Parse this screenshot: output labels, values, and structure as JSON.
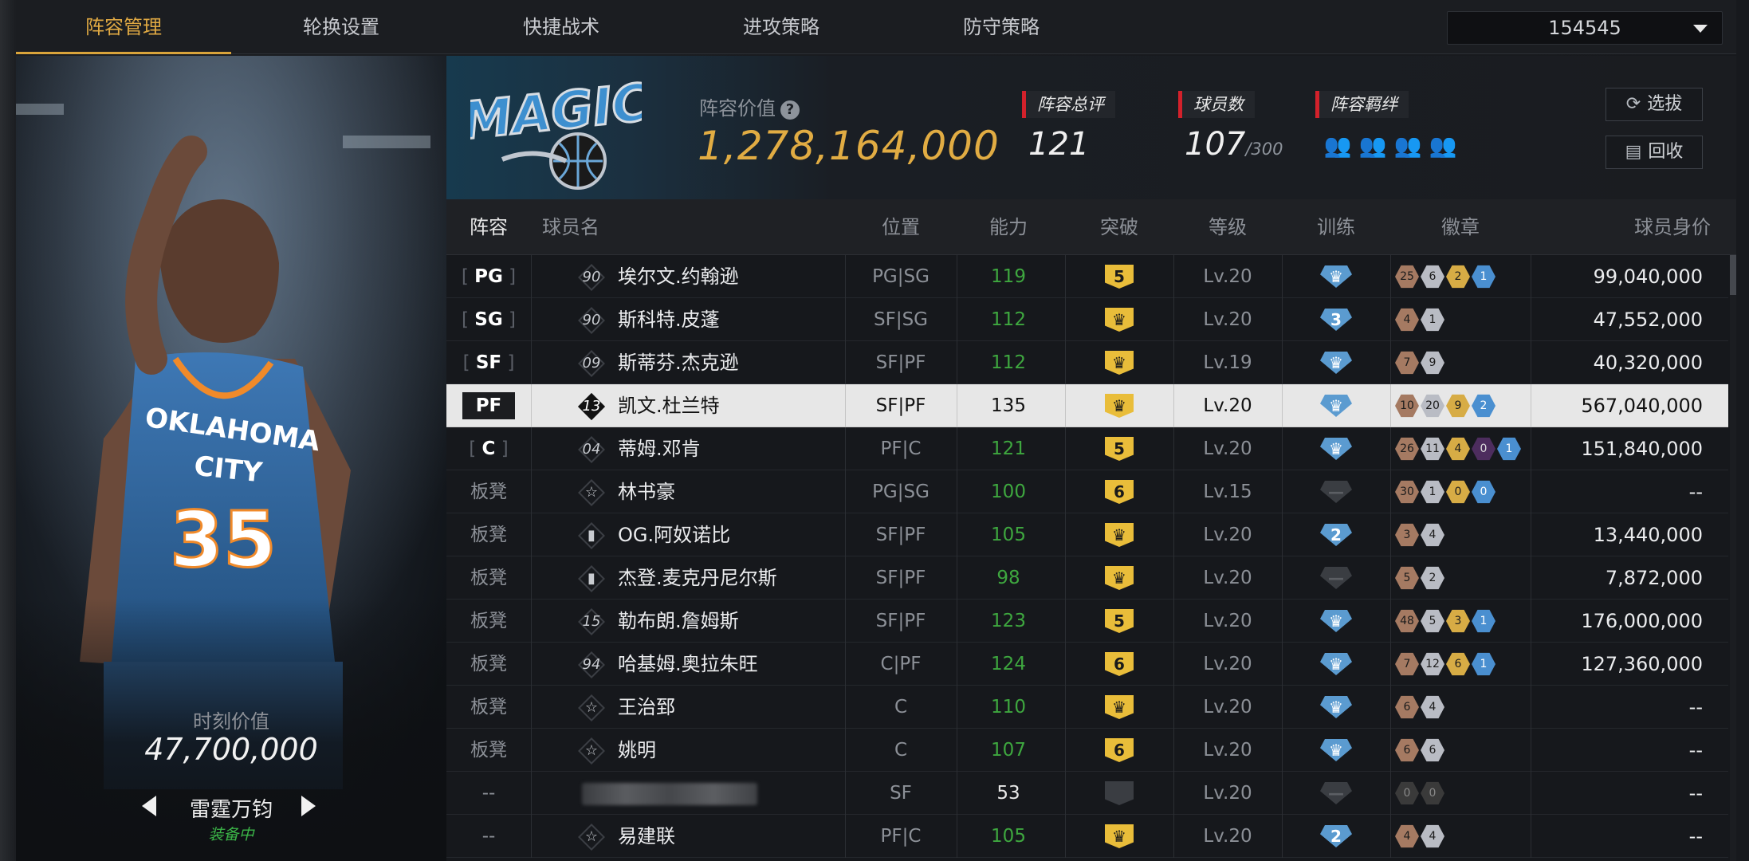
{
  "tabs": [
    {
      "label": "阵容管理",
      "active": true
    },
    {
      "label": "轮换设置"
    },
    {
      "label": "快捷战术"
    },
    {
      "label": "进攻策略"
    },
    {
      "label": "防守策略"
    }
  ],
  "account_select": {
    "value": "154545"
  },
  "left_panel": {
    "moment_value_label": "时刻价值",
    "moment_value": "47,700,000",
    "card_name": "雷霆万钧",
    "card_status": "装备中"
  },
  "header": {
    "lineup_value_label": "阵容价值",
    "lineup_value": "1,278,164,000",
    "total_rating_label": "阵容总评",
    "total_rating": "121",
    "player_count_label": "球员数",
    "player_count": "107",
    "player_count_max": "/300",
    "bonds_label": "阵容羁绊",
    "bond_icons": [
      "bond-bronze-icon",
      "bond-silver-icon",
      "bond-gold-icon",
      "bond-blue-icon"
    ],
    "draft_button": "选拔",
    "recycle_button": "回收"
  },
  "columns": [
    "阵容",
    "球员名",
    "位置",
    "能力",
    "突破",
    "等级",
    "训练",
    "徽章",
    "球员身价"
  ],
  "rows": [
    {
      "slot": "PG",
      "slot_type": "starter",
      "num": "90",
      "name": "埃尔文.约翰逊",
      "position": "PG|SG",
      "ability": "119",
      "breakthrough": "5",
      "level": "Lv.20",
      "training": "",
      "badges": [
        [
          "25",
          "b"
        ],
        [
          "6",
          "s"
        ],
        [
          "2",
          "g"
        ],
        [
          "1",
          "h"
        ]
      ],
      "price": "99,040,000"
    },
    {
      "slot": "SG",
      "slot_type": "starter",
      "num": "90",
      "name": "斯科特.皮蓬",
      "position": "SF|SG",
      "ability": "112",
      "breakthrough": "crown",
      "level": "Lv.20",
      "training": "3",
      "badges": [
        [
          "4",
          "b"
        ],
        [
          "1",
          "s"
        ]
      ],
      "price": "47,552,000"
    },
    {
      "slot": "SF",
      "slot_type": "starter",
      "num": "09",
      "name": "斯蒂芬.杰克逊",
      "position": "SF|PF",
      "ability": "112",
      "breakthrough": "crown",
      "level": "Lv.19",
      "training": "",
      "badges": [
        [
          "7",
          "b"
        ],
        [
          "9",
          "s"
        ]
      ],
      "price": "40,320,000"
    },
    {
      "slot": "PF",
      "slot_type": "starter",
      "num": "13",
      "name": "凯文.杜兰特",
      "position": "SF|PF",
      "ability": "135",
      "breakthrough": "crown",
      "level": "Lv.20",
      "training": "",
      "badges": [
        [
          "10",
          "b"
        ],
        [
          "20",
          "s"
        ],
        [
          "9",
          "g"
        ],
        [
          "2",
          "h"
        ]
      ],
      "price": "567,040,000",
      "selected": true
    },
    {
      "slot": "C",
      "slot_type": "starter",
      "num": "04",
      "name": "蒂姆.邓肯",
      "position": "PF|C",
      "ability": "121",
      "breakthrough": "5",
      "level": "Lv.20",
      "training": "",
      "badges": [
        [
          "26",
          "b"
        ],
        [
          "11",
          "s"
        ],
        [
          "4",
          "g"
        ],
        [
          "0",
          "p"
        ],
        [
          "1",
          "h"
        ]
      ],
      "price": "151,840,000"
    },
    {
      "slot": "板凳",
      "slot_type": "bench",
      "num": "☆",
      "name": "林书豪",
      "position": "PG|SG",
      "ability": "100",
      "breakthrough": "6",
      "level": "Lv.15",
      "training": "grey",
      "badges": [
        [
          "30",
          "b"
        ],
        [
          "1",
          "s"
        ],
        [
          "0",
          "g"
        ],
        [
          "0",
          "h"
        ]
      ],
      "price": "--"
    },
    {
      "slot": "板凳",
      "slot_type": "bench",
      "num": "▮",
      "name": "OG.阿奴诺比",
      "position": "SF|PF",
      "ability": "105",
      "breakthrough": "crown",
      "level": "Lv.20",
      "training": "2",
      "badges": [
        [
          "3",
          "b"
        ],
        [
          "4",
          "s"
        ]
      ],
      "price": "13,440,000"
    },
    {
      "slot": "板凳",
      "slot_type": "bench",
      "num": "▮",
      "name": "杰登.麦克丹尼尔斯",
      "position": "SF|PF",
      "ability": "98",
      "breakthrough": "crown",
      "level": "Lv.20",
      "training": "grey",
      "badges": [
        [
          "5",
          "b"
        ],
        [
          "2",
          "s"
        ]
      ],
      "price": "7,872,000"
    },
    {
      "slot": "板凳",
      "slot_type": "bench",
      "num": "15",
      "name": "勒布朗.詹姆斯",
      "position": "SF|PF",
      "ability": "123",
      "breakthrough": "5",
      "level": "Lv.20",
      "training": "",
      "badges": [
        [
          "48",
          "b"
        ],
        [
          "5",
          "s"
        ],
        [
          "3",
          "g"
        ],
        [
          "1",
          "h"
        ]
      ],
      "price": "176,000,000"
    },
    {
      "slot": "板凳",
      "slot_type": "bench",
      "num": "94",
      "name": "哈基姆.奥拉朱旺",
      "position": "C|PF",
      "ability": "124",
      "breakthrough": "6",
      "level": "Lv.20",
      "training": "",
      "badges": [
        [
          "7",
          "b"
        ],
        [
          "12",
          "s"
        ],
        [
          "6",
          "g"
        ],
        [
          "1",
          "h"
        ]
      ],
      "price": "127,360,000"
    },
    {
      "slot": "板凳",
      "slot_type": "bench",
      "num": "☆",
      "name": "王治郅",
      "position": "C",
      "ability": "110",
      "breakthrough": "crown",
      "level": "Lv.20",
      "training": "",
      "badges": [
        [
          "6",
          "b"
        ],
        [
          "4",
          "s"
        ]
      ],
      "price": "--"
    },
    {
      "slot": "板凳",
      "slot_type": "bench",
      "num": "☆",
      "name": "姚明",
      "position": "C",
      "ability": "107",
      "breakthrough": "6",
      "level": "Lv.20",
      "training": "",
      "badges": [
        [
          "6",
          "b"
        ],
        [
          "6",
          "s"
        ]
      ],
      "price": "--"
    },
    {
      "slot": "--",
      "slot_type": "bench",
      "num": "",
      "name": "",
      "blurred": true,
      "position": "SF",
      "ability": "53",
      "ability_plain": true,
      "breakthrough": "grey",
      "level": "Lv.20",
      "training": "grey",
      "badges": [
        [
          "0",
          "dk"
        ],
        [
          "0",
          "dk"
        ]
      ],
      "price": "--"
    },
    {
      "slot": "--",
      "slot_type": "bench",
      "num": "☆",
      "name": "易建联",
      "position": "PF|C",
      "ability": "105",
      "breakthrough": "crown",
      "level": "Lv.20",
      "training": "2",
      "badges": [
        [
          "4",
          "b"
        ],
        [
          "4",
          "s"
        ]
      ],
      "price": "--"
    }
  ],
  "colors": {
    "accent": "#e0a943",
    "ability_green": "#3ea73f",
    "stat_red": "#d3212b",
    "status_green": "#3bb548"
  }
}
